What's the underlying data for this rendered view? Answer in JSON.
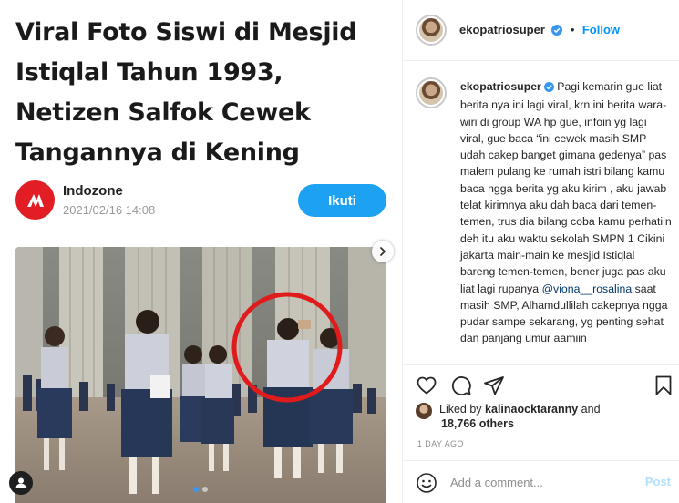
{
  "article": {
    "headline": "Viral Foto Siswi di Mesjid Istiqlal Tahun 1993, Netizen Salfok Cewek Tangannya di Kening",
    "publisher": "Indozone",
    "date": "2021/02/16 14:08",
    "follow_label": "Ikuti"
  },
  "post": {
    "author": "ekopatriosuper",
    "separator": "•",
    "follow_label": "Follow",
    "caption": "Pagi kemarin gue liat berita nya ini lagi viral, krn ini berita wara-wiri di group WA hp gue, infoin yg lagi viral, gue baca “ini cewek masih SMP udah cakep banget gimana gedenya” pas malem pulang ke rumah istri bilang kamu baca ngga berita yg aku kirim , aku jawab telat kirimnya aku dah baca dari temen-temen, trus dia bilang coba kamu perhatiin deh itu aku waktu sekolah SMPN 1 Cikini jakarta main-main ke mesjid Istiqlal bareng temen-temen, bener juga pas aku liat lagi rupanya",
    "mention": "@viona__rosalina",
    "caption_end": "saat masih SMP, Alhamdullilah cakepnya ngga pudar sampe sekarang, yg penting sehat dan panjang umur aamiin",
    "liked_by_prefix": "Liked by",
    "liked_by_user": "kalinaocktaranny",
    "liked_by_and": "and",
    "likes_count": "18,766 others",
    "time_ago": "1 DAY AGO",
    "comment_placeholder": "Add a comment...",
    "post_label": "Post",
    "carousel_total": 2,
    "carousel_active": 1
  },
  "colors": {
    "brand_red": "#e21d24",
    "follow_blue": "#1da1f2",
    "instagram_blue": "#0095f6",
    "verified_blue": "#3897f0"
  },
  "icons": [
    "indozone-logo-icon",
    "verified-badge-icon",
    "heart-icon",
    "comment-icon",
    "share-icon",
    "bookmark-icon",
    "emoji-icon",
    "chevron-right-icon",
    "tag-user-icon"
  ]
}
